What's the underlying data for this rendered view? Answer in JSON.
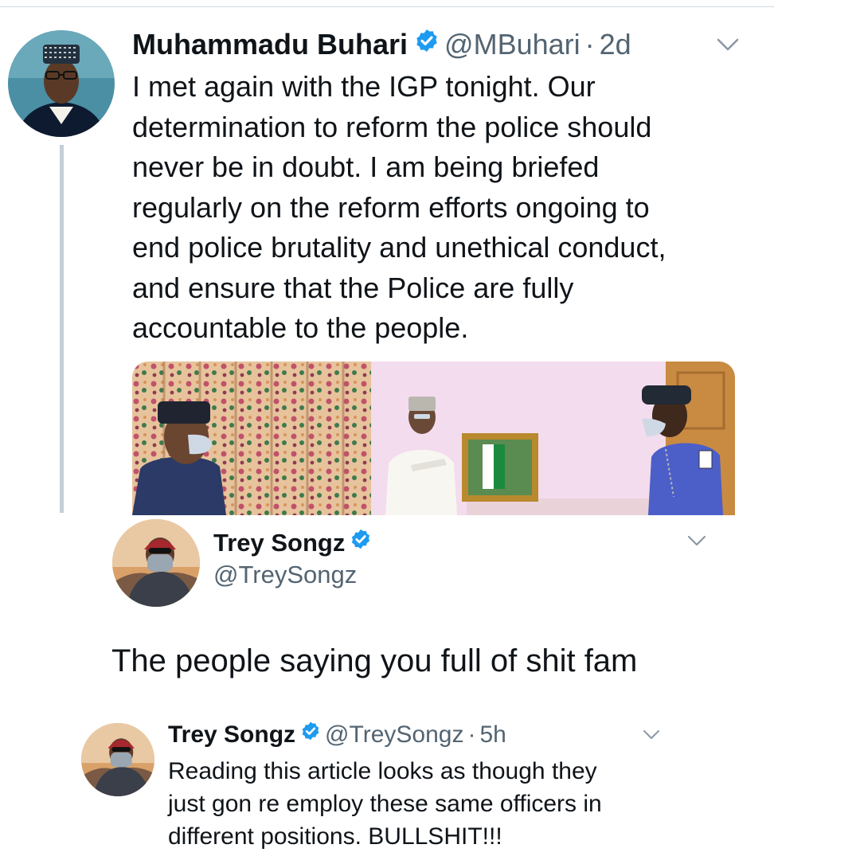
{
  "tweets": {
    "buhari": {
      "name": "Muhammadu Buhari",
      "handle": "@MBuhari",
      "separator": "·",
      "time": "2d",
      "text": "I met again with the IGP tonight. Our\ndetermination to reform the police should\nnever be in doubt. I am being briefed\nregularly on the reform efforts ongoing to\nend police brutality and unethical conduct,\nand ensure that the Police are fully\naccountable to the people."
    },
    "trey_main": {
      "name": "Trey Songz",
      "handle": "@TreySongz",
      "text": "The people saying you full of shit fam"
    },
    "trey_reply": {
      "name": "Trey Songz",
      "handle": "@TreySongz",
      "separator": "·",
      "time": "5h",
      "text": "Reading this article looks as though they\njust gon re employ these same officers in\ndifferent positions. BULLSHIT!!!"
    }
  },
  "icons": {
    "verified": "verified-badge-icon",
    "menu": "chevron-down-icon"
  },
  "colors": {
    "verified_blue": "#1d9bf0",
    "secondary_text": "#536471",
    "primary_text": "#0f1419",
    "thread_line": "#c4cfd6"
  }
}
